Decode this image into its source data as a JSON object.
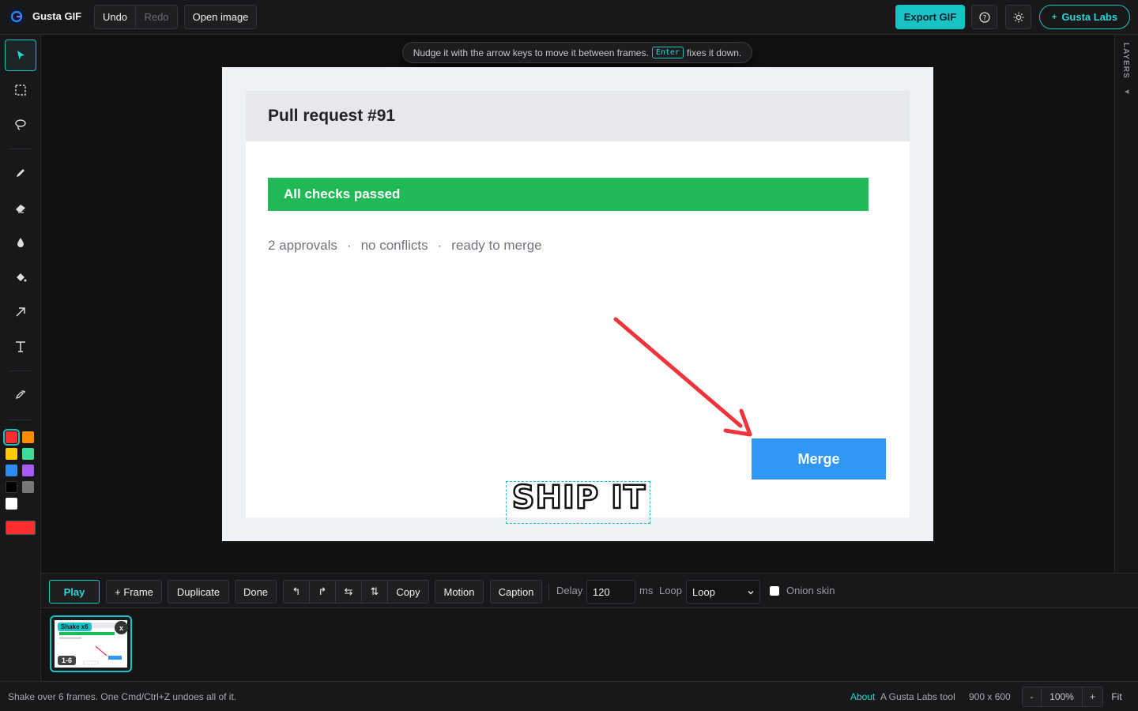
{
  "app": {
    "name": "Gusta GIF",
    "undo_label": "Undo",
    "redo_label": "Redo",
    "open_label": "Open image",
    "export_label": "Export GIF",
    "labs_label": "Gusta Labs",
    "accent": "#17c3c3"
  },
  "tools": [
    "select-icon",
    "marquee-icon",
    "lasso-icon",
    "pencil-icon",
    "eraser-icon",
    "blur-icon",
    "fill-icon",
    "arrow-icon",
    "text-icon",
    "eyedropper-icon"
  ],
  "palette": {
    "swatches": [
      "#ff2e2e",
      "#ff8c00",
      "#ffcc00",
      "#3ddc97",
      "#2d8cf0",
      "#a45cf5",
      "#000000",
      "#777777",
      "#ffffff"
    ],
    "selected": "#ff2e2e",
    "current": "#ff2e2e"
  },
  "layers_label": "LAYERS",
  "hint": {
    "before": "Nudge it with the arrow keys to move it between frames.",
    "key": "Enter",
    "after": "fixes it down."
  },
  "canvas_content": {
    "title": "Pull request #91",
    "checks": "All checks passed",
    "meta": [
      "2 approvals",
      "·",
      "no conflicts",
      "·",
      "ready to merge"
    ],
    "merge_label": "Merge",
    "caption": "SHIP IT"
  },
  "timeline": {
    "play": "Play",
    "add_frame": "+ Frame",
    "duplicate": "Duplicate",
    "done": "Done",
    "copy": "Copy",
    "motion": "Motion",
    "caption": "Caption",
    "delay_label": "Delay",
    "delay_value": "120",
    "ms": "ms",
    "loop_label": "Loop",
    "loop_value": "Loop",
    "onion": "Onion skin"
  },
  "frames": [
    {
      "tag": "Shake x6",
      "range": "1-6",
      "close": "x"
    }
  ],
  "status": {
    "message": "Shake over 6 frames. One Cmd/Ctrl+Z undoes all of it.",
    "about": "About",
    "credit": "A Gusta Labs tool",
    "size": "900 x 600",
    "zoom_out": "-",
    "zoom": "100%",
    "zoom_in": "+",
    "fit": "Fit"
  }
}
